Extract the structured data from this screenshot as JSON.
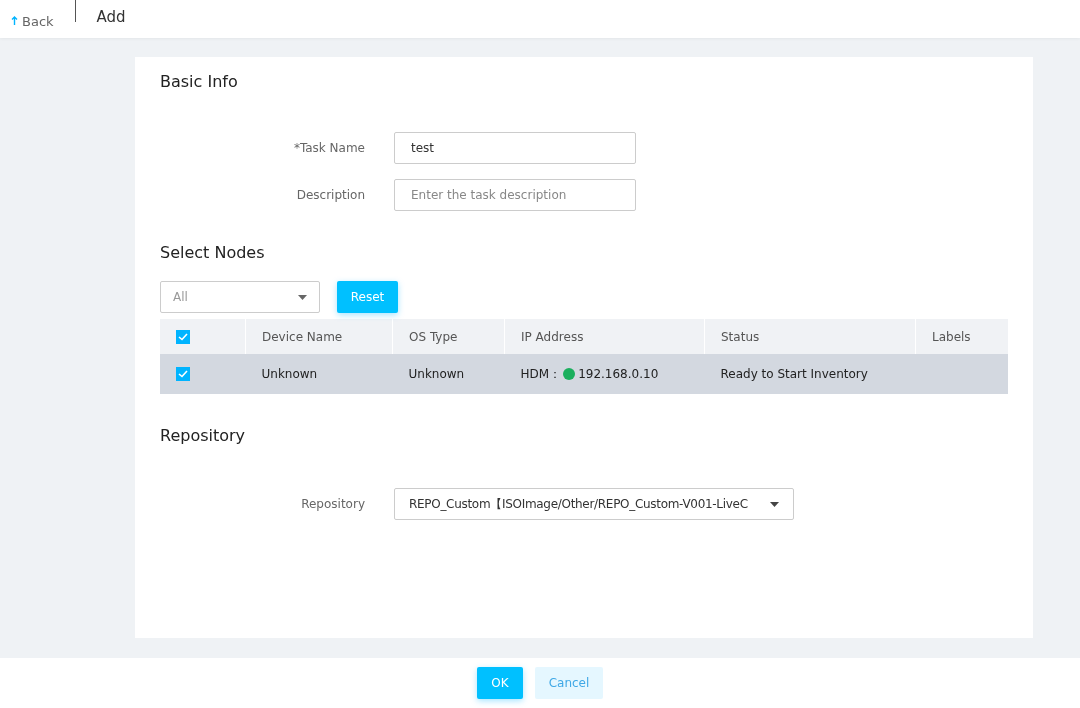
{
  "header": {
    "back": "Back",
    "title": "Add"
  },
  "basic_info": {
    "heading": "Basic Info",
    "fields": [
      {
        "label": "*Task Name",
        "value": "test"
      },
      {
        "label": "Description",
        "placeholder": "Enter the task description"
      }
    ]
  },
  "select_nodes": {
    "heading": "Select Nodes",
    "filter": {
      "value": "All"
    },
    "reset": "Reset",
    "table": {
      "select_all": {
        "checked": true
      },
      "columns": [
        "Device Name",
        "OS Type",
        "IP Address",
        "Status",
        "Labels"
      ],
      "rows": [
        {
          "selected": true,
          "checked": true,
          "device_name": "Unknown",
          "os_type": "Unknown",
          "ip_prefix": "HDM：",
          "color": "#1aaf5d",
          "ip": "192.168.0.10",
          "status": "Ready to Start Inventory"
        }
      ]
    }
  },
  "repository": {
    "heading": "Repository",
    "label": "Repository",
    "value": "REPO_Custom【ISOImage/Other/REPO_Custom-V001-LiveC"
  },
  "footer": {
    "ok": "OK",
    "cancel": "Cancel"
  }
}
